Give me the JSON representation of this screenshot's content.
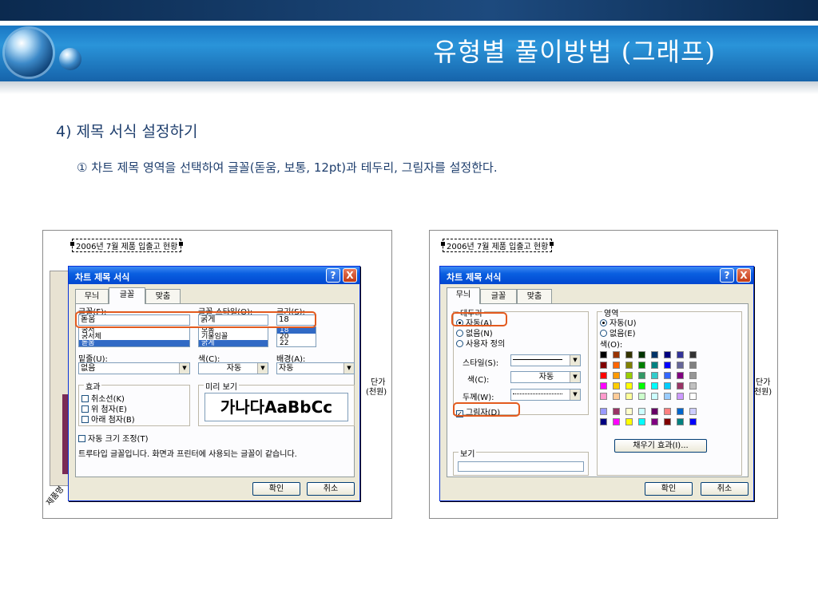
{
  "header": {
    "title": "유형별 풀이방법 (그래프)"
  },
  "section": {
    "heading": "4) 제목 서식 설정하기",
    "instruction": "① 차트 제목 영역을 선택하여 글꼴(돋움, 보통, 12pt)과 테두리, 그림자를 설정한다."
  },
  "left": {
    "chart_title": "2006년 7월 제품 입출고 현황",
    "side_label_1": "단가",
    "side_label_2": "(천원)",
    "axis_label": "제품명",
    "dialog": {
      "title": "차트 제목 서식",
      "help": "?",
      "close": "X",
      "tabs": [
        "무늬",
        "글꼴",
        "맞춤"
      ],
      "font_label": "글꼴(F):",
      "font_value": "돋움",
      "font_list": [
        "궁서",
        "궁서체",
        "돋움"
      ],
      "style_label": "글꼴 스타일(O):",
      "style_value": "굵게",
      "style_list": [
        "보통",
        "기울임꼴",
        "굵게"
      ],
      "size_label": "크기(S):",
      "size_value": "18",
      "size_list": [
        "18",
        "20",
        "22"
      ],
      "underline_label": "밑줄(U):",
      "underline_value": "없음",
      "color_label": "색(C):",
      "color_value": "자동",
      "bg_label": "배경(A):",
      "bg_value": "자동",
      "effects_label": "효과",
      "effects": [
        "취소선(K)",
        "위 첨자(E)",
        "아래 첨자(B)"
      ],
      "preview_label": "미리 보기",
      "preview_text": "가나다AaBbCc",
      "autoscale": "자동 크기 조정(T)",
      "note": "트루타입 글꼴입니다. 화면과 프린터에 사용되는 글꼴이 같습니다.",
      "ok": "확인",
      "cancel": "취소"
    }
  },
  "right": {
    "chart_title": "2006년 7월 제품 입출고 현황",
    "side_label_1": "단가",
    "side_label_2": "(천원)",
    "dialog": {
      "title": "차트 제목 서식",
      "help": "?",
      "close": "X",
      "tabs": [
        "무늬",
        "글꼴",
        "맞춤"
      ],
      "border_label": "테두리",
      "border_options": [
        "자동(A)",
        "없음(N)",
        "사용자 정의"
      ],
      "style_label": "스타일(S):",
      "color_label": "색(C):",
      "color_value": "자동",
      "weight_label": "두께(W):",
      "shadow_label": "그림자(D)",
      "area_label": "영역",
      "area_options": [
        "자동(U)",
        "없음(E)"
      ],
      "area_color_label": "색(O):",
      "fill_effects": "채우기 효과(I)...",
      "sample_label": "보기",
      "ok": "확인",
      "cancel": "취소"
    },
    "palette": [
      [
        "#000000",
        "#993300",
        "#333300",
        "#003300",
        "#003366",
        "#000080",
        "#333399",
        "#333333"
      ],
      [
        "#800000",
        "#ff6600",
        "#808000",
        "#008000",
        "#008080",
        "#0000ff",
        "#666699",
        "#808080"
      ],
      [
        "#ff0000",
        "#ff9900",
        "#99cc00",
        "#339966",
        "#33cccc",
        "#3366ff",
        "#800080",
        "#969696"
      ],
      [
        "#ff00ff",
        "#ffcc00",
        "#ffff00",
        "#00ff00",
        "#00ffff",
        "#00ccff",
        "#993366",
        "#c0c0c0"
      ],
      [
        "#ff99cc",
        "#ffcc99",
        "#ffff99",
        "#ccffcc",
        "#ccffff",
        "#99ccff",
        "#cc99ff",
        "#ffffff"
      ],
      [
        "#9999ff",
        "#993366",
        "#ffffcc",
        "#ccffff",
        "#660066",
        "#ff8080",
        "#0066cc",
        "#ccccff"
      ],
      [
        "#000080",
        "#ff00ff",
        "#ffff00",
        "#00ffff",
        "#800080",
        "#800000",
        "#008080",
        "#0000ff"
      ]
    ]
  }
}
